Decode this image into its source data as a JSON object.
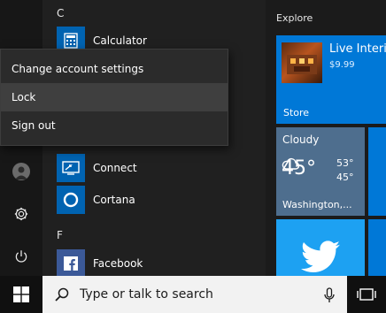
{
  "rail": {
    "icons": [
      "user-avatar-icon",
      "settings-gear-icon",
      "power-icon"
    ]
  },
  "app_list": {
    "letter_c": "C",
    "letter_f": "F",
    "apps": {
      "calculator": "Calculator",
      "connect": "Connect",
      "cortana": "Cortana",
      "facebook": "Facebook"
    }
  },
  "context_menu": {
    "items": [
      "Change account settings",
      "Lock",
      "Sign out"
    ],
    "highlighted": "Lock"
  },
  "tiles": {
    "section_title": "Explore",
    "store": {
      "app_title": "Live Interi",
      "price": "$9.99",
      "label": "Store"
    },
    "weather": {
      "condition": "Cloudy",
      "temp": "45°",
      "high": "53°",
      "low": "45°",
      "location": "Washington,..."
    },
    "twitter": {
      "icon": "twitter-bird-icon"
    }
  },
  "taskbar": {
    "search_placeholder": "Type or talk to search",
    "icons": [
      "windows-logo-icon",
      "microphone-icon",
      "task-view-icon"
    ]
  },
  "colors": {
    "accent_blue": "#0078d7",
    "weather_tile": "#4e6e8e",
    "twitter_blue": "#1da1f2"
  }
}
